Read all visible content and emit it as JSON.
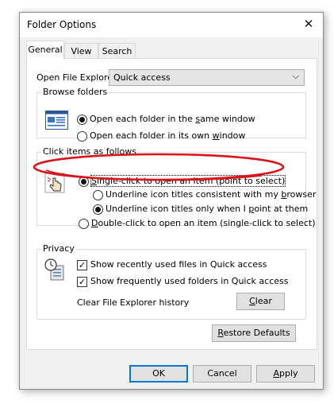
{
  "window": {
    "title": "Folder Options",
    "close_glyph": "✕"
  },
  "tabs": [
    {
      "label": "General",
      "active": true
    },
    {
      "label": "View",
      "active": false
    },
    {
      "label": "Search",
      "active": false
    }
  ],
  "open_explorer": {
    "label": "Open File Explorer to:",
    "value": "Quick access",
    "arrow_glyph": "⌵"
  },
  "browse_folders": {
    "title": "Browse folders",
    "icon": "browse-folders-icon",
    "options": [
      {
        "pre": "Open each folder in the ",
        "acc": "s",
        "post": "ame window",
        "selected": true
      },
      {
        "pre": "Open each folder in its own ",
        "acc": "w",
        "post": "indow",
        "selected": false
      }
    ]
  },
  "click_items": {
    "title": "Click items as follows",
    "icon": "hand-pointer-icon",
    "single_click": {
      "acc": "S",
      "post": "ingle-click to open an item (point to select)",
      "selected": true
    },
    "underline_consistent": {
      "pre": "Underline icon titles consistent with my ",
      "acc": "b",
      "post": "rowser",
      "selected": false
    },
    "underline_point": {
      "pre": "Underline icon titles only when I ",
      "acc": "p",
      "post": "oint at them",
      "selected": true
    },
    "double_click": {
      "acc": "D",
      "post": "ouble-click to open an item (single-click to select)",
      "selected": false
    }
  },
  "privacy": {
    "title": "Privacy",
    "icon": "privacy-clock-icon",
    "recent_files": {
      "label": "Show recently used files in Quick access",
      "checked": true
    },
    "frequent_folders": {
      "label": "Show frequently used folders in Quick access",
      "checked": true
    },
    "clear_history_label": "Clear File Explorer history",
    "clear_button": {
      "acc": "C",
      "post": "lear"
    }
  },
  "restore_defaults": {
    "acc": "R",
    "post": "estore Defaults"
  },
  "footer": {
    "ok": "OK",
    "cancel": "Cancel",
    "apply": {
      "acc": "A",
      "post": "pply"
    }
  },
  "annotation": {
    "color": "#d9151b",
    "shape": "ellipse"
  },
  "check_glyph": "✓"
}
